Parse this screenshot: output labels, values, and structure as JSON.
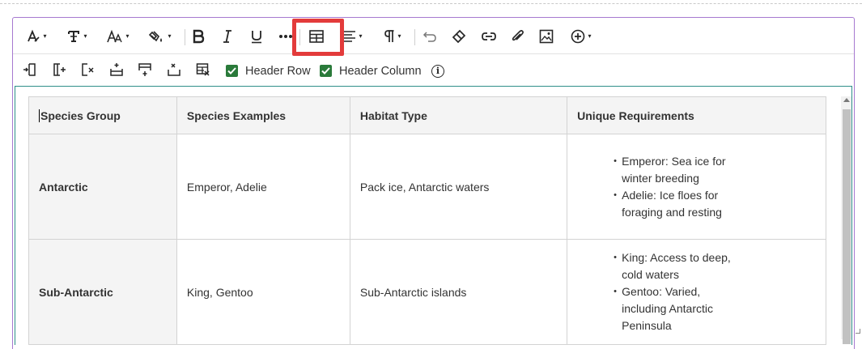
{
  "toolbar": {
    "icons": [
      "text-style-icon",
      "font-type-icon",
      "font-size-icon",
      "text-color-icon",
      "bold-icon",
      "italic-icon",
      "underline-icon",
      "more-icon",
      "table-icon",
      "align-icon",
      "paragraph-icon",
      "undo-icon",
      "eraser-icon",
      "link-icon",
      "attach-icon",
      "image-icon",
      "add-content-icon"
    ],
    "caret": "▾"
  },
  "table_toolbar": {
    "header_row_label": "Header Row",
    "header_column_label": "Header Column",
    "info_label": "i"
  },
  "table": {
    "headers": [
      "Species Group",
      "Species Examples",
      "Habitat Type",
      "Unique Requirements"
    ],
    "rows": [
      {
        "group": "Antarctic",
        "examples": "Emperor, Adelie",
        "habitat": "Pack ice, Antarctic waters",
        "requirements": [
          "Emperor: Sea ice for winter breeding",
          "Adelie: Ice floes for foraging and resting"
        ]
      },
      {
        "group": "Sub-Antarctic",
        "examples": "King, Gentoo",
        "habitat": "Sub-Antarctic islands",
        "requirements": [
          "King: Access to deep, cold waters",
          "Gentoo: Varied, including Antarctic Peninsula"
        ]
      }
    ]
  },
  "colors": {
    "highlight": "#e33b3b",
    "checkbox": "#2a7a3a",
    "editor_border": "#a679d0",
    "content_border": "#2f8f8a"
  }
}
